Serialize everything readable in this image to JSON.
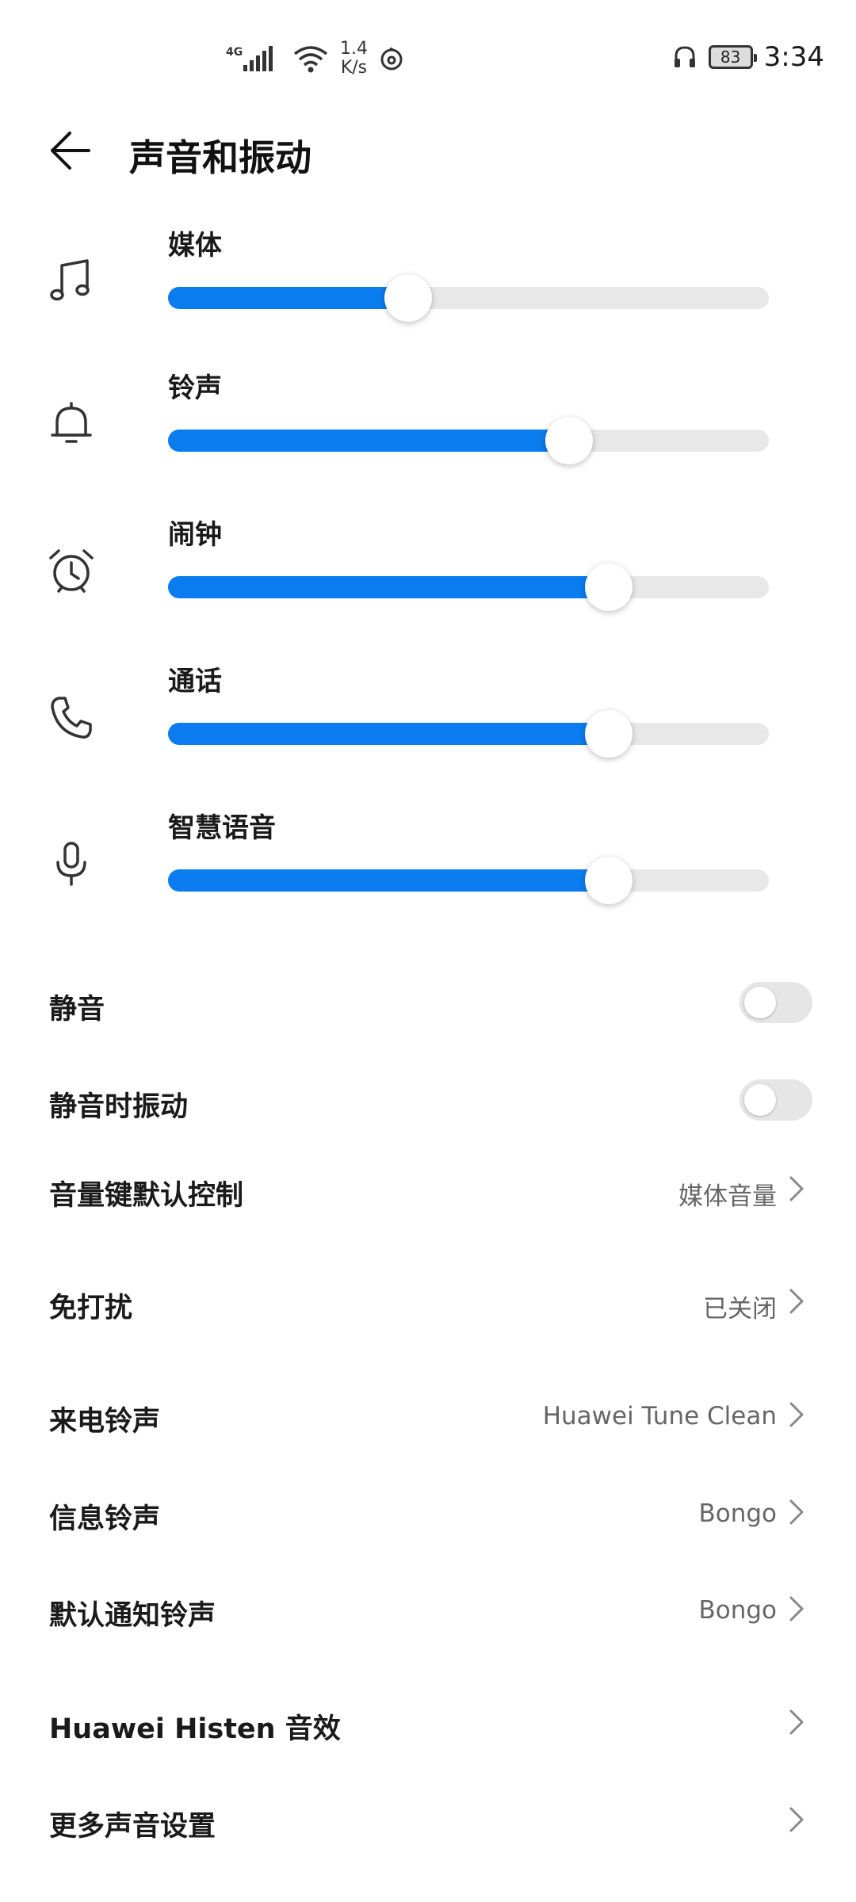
{
  "status_bar": {
    "network": "4G",
    "speed_value": "1.4",
    "speed_unit": "K/s",
    "battery": "83",
    "time": "3:34",
    "icons": [
      "signal-icon",
      "wifi-icon",
      "netease-music-icon",
      "headset-icon",
      "battery-icon"
    ]
  },
  "header": {
    "title": "声音和振动"
  },
  "volumes": [
    {
      "label": "媒体",
      "icon": "music-note-icon",
      "level": 0.4
    },
    {
      "label": "铃声",
      "icon": "bell-icon",
      "level": 0.667
    },
    {
      "label": "闹钟",
      "icon": "alarm-clock-icon",
      "level": 0.733
    },
    {
      "label": "通话",
      "icon": "phone-icon",
      "level": 0.733
    },
    {
      "label": "智慧语音",
      "icon": "microphone-icon",
      "level": 0.733
    }
  ],
  "toggles": [
    {
      "label": "静音",
      "on": false
    },
    {
      "label": "静音时振动",
      "on": false
    }
  ],
  "settings": [
    {
      "label": "音量键默认控制",
      "value": "媒体音量"
    },
    {
      "label": "免打扰",
      "value": "已关闭"
    },
    {
      "label": "来电铃声",
      "value": "Huawei Tune Clean"
    },
    {
      "label": "信息铃声",
      "value": "Bongo"
    },
    {
      "label": "默认通知铃声",
      "value": "Bongo"
    },
    {
      "label": "Huawei Histen 音效",
      "value": ""
    },
    {
      "label": "更多声音设置",
      "value": ""
    }
  ],
  "colors": {
    "accent": "#0a7cf0",
    "track": "#e8e8e8",
    "toggle_off": "#e6e6e6"
  }
}
